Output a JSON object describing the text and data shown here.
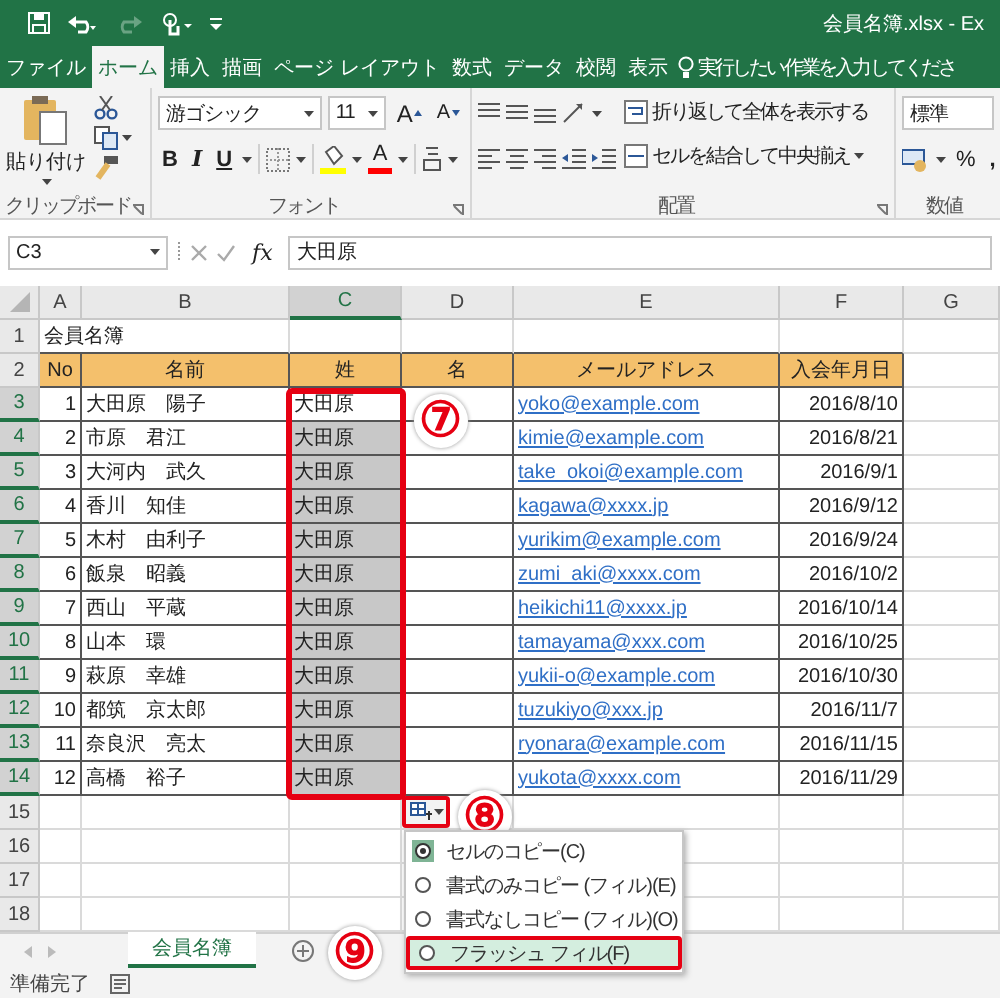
{
  "title_bar": {
    "title": "会員名簿.xlsx - Ex"
  },
  "ribbon_tabs": [
    {
      "label": "ファイル",
      "selected": false
    },
    {
      "label": "ホーム",
      "selected": true
    },
    {
      "label": "挿入",
      "selected": false
    },
    {
      "label": "描画",
      "selected": false
    },
    {
      "label": "ページ レイアウト",
      "selected": false
    },
    {
      "label": "数式",
      "selected": false
    },
    {
      "label": "データ",
      "selected": false
    },
    {
      "label": "校閲",
      "selected": false
    },
    {
      "label": "表示",
      "selected": false
    }
  ],
  "tell_me": {
    "placeholder": "実行したい作業を入力してくださ"
  },
  "ribbon": {
    "clipboard": {
      "paste": "貼り付け",
      "label": "クリップボード"
    },
    "font": {
      "name": "游ゴシック",
      "size": "11",
      "grow": "A",
      "shrink": "A",
      "style_buttons": [
        "B",
        "I",
        "U"
      ],
      "font_color": "A",
      "label": "フォント"
    },
    "alignment": {
      "wrap": "折り返して全体を表示する",
      "merge": "セルを結合して中央揃え",
      "label": "配置"
    },
    "number": {
      "format": "標準",
      "percent": "%",
      "comma": ",",
      "label": "数値"
    }
  },
  "formula_bar": {
    "name_box": "C3",
    "fx": "fx",
    "value": "大田原"
  },
  "sheet": {
    "callout": "⑦",
    "columns": [
      {
        "label": "A",
        "selected": false
      },
      {
        "label": "B",
        "selected": false
      },
      {
        "label": "C",
        "selected": true
      },
      {
        "label": "D",
        "selected": false
      },
      {
        "label": "E",
        "selected": false
      },
      {
        "label": "F",
        "selected": false
      },
      {
        "label": "G",
        "selected": false
      }
    ],
    "title_row": {
      "row": "1",
      "text": "会員名簿"
    },
    "header_row": {
      "row": "2",
      "cells": [
        "No",
        "名前",
        "姓",
        "名",
        "メールアドレス",
        "入会年月日"
      ]
    },
    "rows": [
      {
        "row": "3",
        "no": "1",
        "name": "大田原　陽子",
        "surname": "大田原",
        "email": "yoko@example.com",
        "date": "2016/8/10",
        "selected": true,
        "active": true
      },
      {
        "row": "4",
        "no": "2",
        "name": "市原　君江",
        "surname": "大田原",
        "email": "kimie@example.com",
        "date": "2016/8/21",
        "selected": true,
        "active": false
      },
      {
        "row": "5",
        "no": "3",
        "name": "大河内　武久",
        "surname": "大田原",
        "email": "take_okoi@example.com",
        "date": "2016/9/1",
        "selected": true,
        "active": false
      },
      {
        "row": "6",
        "no": "4",
        "name": "香川　知佳",
        "surname": "大田原",
        "email": "kagawa@xxxx.jp",
        "date": "2016/9/12",
        "selected": true,
        "active": false
      },
      {
        "row": "7",
        "no": "5",
        "name": "木村　由利子",
        "surname": "大田原",
        "email": "yurikim@example.com",
        "date": "2016/9/24",
        "selected": true,
        "active": false
      },
      {
        "row": "8",
        "no": "6",
        "name": "飯泉　昭義",
        "surname": "大田原",
        "email": "zumi_aki@xxxx.com",
        "date": "2016/10/2",
        "selected": true,
        "active": false
      },
      {
        "row": "9",
        "no": "7",
        "name": "西山　平蔵",
        "surname": "大田原",
        "email": "heikichi11@xxxx.jp",
        "date": "2016/10/14",
        "selected": true,
        "active": false
      },
      {
        "row": "10",
        "no": "8",
        "name": "山本　環",
        "surname": "大田原",
        "email": "tamayama@xxx.com",
        "date": "2016/10/25",
        "selected": true,
        "active": false
      },
      {
        "row": "11",
        "no": "9",
        "name": "萩原　幸雄",
        "surname": "大田原",
        "email": "yukii-o@example.com",
        "date": "2016/10/30",
        "selected": true,
        "active": false
      },
      {
        "row": "12",
        "no": "10",
        "name": "都筑　京太郎",
        "surname": "大田原",
        "email": "tuzukiyo@xxx.jp",
        "date": "2016/11/7",
        "selected": true,
        "active": false
      },
      {
        "row": "13",
        "no": "11",
        "name": "奈良沢　亮太",
        "surname": "大田原",
        "email": "ryonara@example.com",
        "date": "2016/11/15",
        "selected": true,
        "active": false
      },
      {
        "row": "14",
        "no": "12",
        "name": "高橋　裕子",
        "surname": "大田原",
        "email": "yukota@xxxx.com",
        "date": "2016/11/29",
        "selected": true,
        "active": false
      }
    ],
    "empty_rows": [
      "15",
      "16",
      "17",
      "18"
    ]
  },
  "autofill_menu": {
    "callout": "⑧",
    "options": [
      {
        "label": "セルのコピー(C)",
        "selected": true,
        "highlighted": false
      },
      {
        "label": "書式のみコピー (フィル)(E)",
        "selected": false,
        "highlighted": false
      },
      {
        "label": "書式なしコピー (フィル)(O)",
        "selected": false,
        "highlighted": false
      },
      {
        "label": "フラッシュ フィル(F)",
        "selected": false,
        "highlighted": true,
        "callout": "⑨"
      }
    ]
  },
  "sheet_tabs": [
    {
      "label": "会員名簿",
      "selected": true
    }
  ],
  "status_bar": {
    "text": "準備完了"
  }
}
